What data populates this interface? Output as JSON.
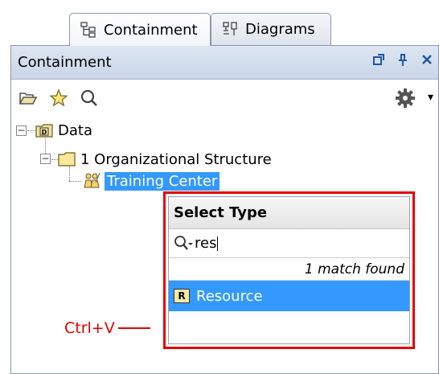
{
  "tabs": [
    {
      "label": "Containment",
      "icon": "containment-icon",
      "active": true
    },
    {
      "label": "Diagrams",
      "icon": "diagrams-icon",
      "active": false
    }
  ],
  "panel": {
    "title": "Containment"
  },
  "tree": {
    "root": {
      "label": "Data",
      "badge": "D"
    },
    "child": {
      "label": "1 Organizational Structure"
    },
    "grandchild": {
      "label": "Training Center"
    }
  },
  "popup": {
    "title": "Select Type",
    "search_value": "res",
    "match_text": "1 match found",
    "result_label": "Resource",
    "result_badge": "R"
  },
  "annotation": {
    "shortcut": "Ctrl+V"
  },
  "colors": {
    "accent": "#3399ff",
    "highlight_border": "#e60000"
  }
}
